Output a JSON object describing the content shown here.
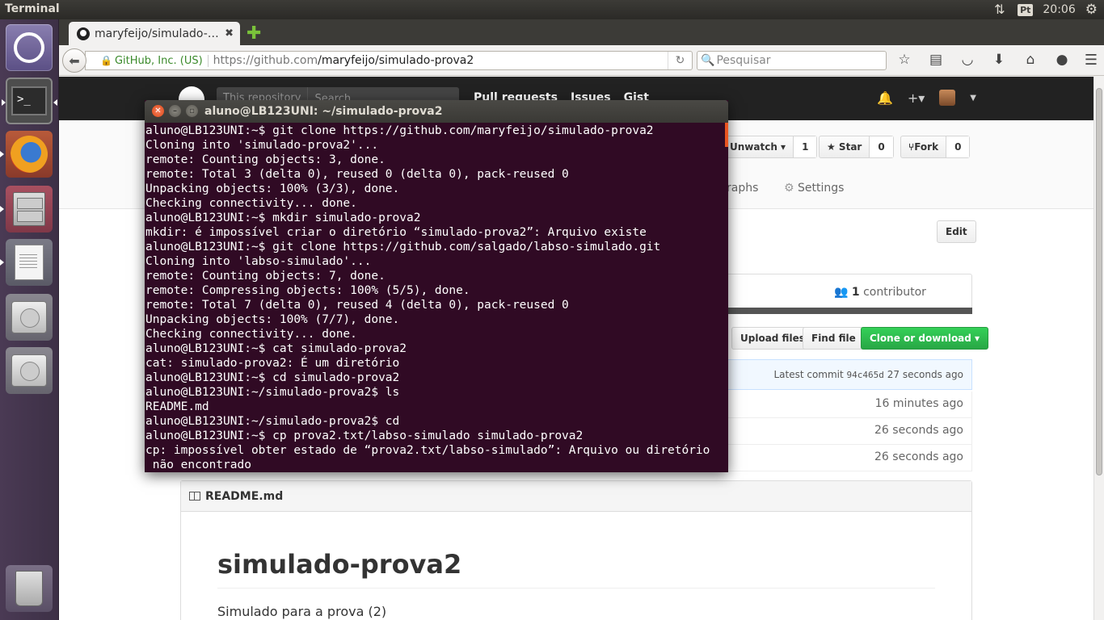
{
  "panel": {
    "app_title": "Terminal",
    "keyboard": "Pt",
    "clock": "20:06"
  },
  "browser": {
    "tab_title": "maryfeijo/simulado-…",
    "identity": "GitHub, Inc. (US)",
    "url_host": "https://github.com",
    "url_path": "/maryfeijo/simulado-prova2",
    "search_placeholder": "Pesquisar"
  },
  "github": {
    "search_scope": "This repository",
    "search_placeholder": "Search",
    "nav": [
      "Pull requests",
      "Issues",
      "Gist"
    ],
    "unwatch_label": "Unwatch ▾",
    "unwatch_count": "1",
    "star_label": "★ Star",
    "star_count": "0",
    "fork_label": "Fork",
    "fork_count": "0",
    "tab_graphs": "raphs",
    "tab_settings": "Settings",
    "edit_label": "Edit",
    "contributors_count": "1",
    "contributors_label": "contributor",
    "upload_label": "Upload files",
    "find_label": "Find file",
    "clone_label": "Clone or download ▾",
    "latest_commit_label": "Latest commit",
    "latest_commit_sha": "94c465d",
    "latest_commit_age": "27 seconds ago",
    "file_ages": [
      "16 minutes ago",
      "26 seconds ago",
      "26 seconds ago"
    ],
    "readme_file": "README.md",
    "readme_title": "simulado-prova2",
    "readme_text": "Simulado para a prova (2)"
  },
  "terminal": {
    "title": "aluno@LB123UNI: ~/simulado-prova2",
    "lines": [
      "aluno@LB123UNI:~$ git clone https://github.com/maryfeijo/simulado-prova2",
      "Cloning into 'simulado-prova2'...",
      "remote: Counting objects: 3, done.",
      "remote: Total 3 (delta 0), reused 0 (delta 0), pack-reused 0",
      "Unpacking objects: 100% (3/3), done.",
      "Checking connectivity... done.",
      "aluno@LB123UNI:~$ mkdir simulado-prova2",
      "mkdir: é impossível criar o diretório “simulado-prova2”: Arquivo existe",
      "aluno@LB123UNI:~$ git clone https://github.com/salgado/labso-simulado.git",
      "Cloning into 'labso-simulado'...",
      "remote: Counting objects: 7, done.",
      "remote: Compressing objects: 100% (5/5), done.",
      "remote: Total 7 (delta 0), reused 4 (delta 0), pack-reused 0",
      "Unpacking objects: 100% (7/7), done.",
      "Checking connectivity... done.",
      "aluno@LB123UNI:~$ cat simulado-prova2",
      "cat: simulado-prova2: É um diretório",
      "aluno@LB123UNI:~$ cd simulado-prova2",
      "aluno@LB123UNI:~/simulado-prova2$ ls",
      "README.md",
      "aluno@LB123UNI:~/simulado-prova2$ cd",
      "aluno@LB123UNI:~$ cp prova2.txt/labso-simulado simulado-prova2",
      "cp: impossível obter estado de “prova2.txt/labso-simulado”: Arquivo ou diretório",
      " não encontrado"
    ]
  }
}
